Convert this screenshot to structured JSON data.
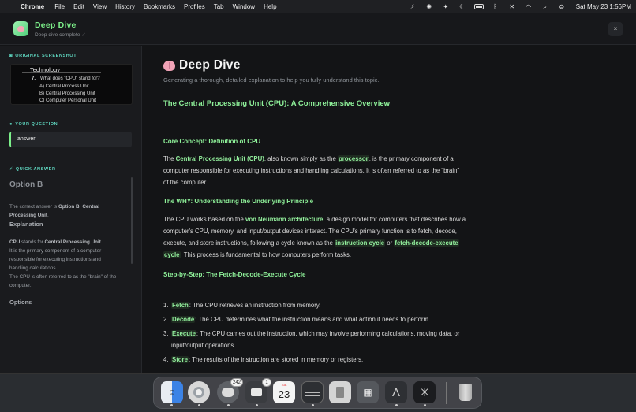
{
  "menubar": {
    "app": "Chrome",
    "items": [
      "File",
      "Edit",
      "View",
      "History",
      "Bookmarks",
      "Profiles",
      "Tab",
      "Window",
      "Help"
    ],
    "clock": "Sat May 23  1:56PM",
    "status_icons": [
      "bolt-icon",
      "brightness-icon",
      "sparkle-icon",
      "moon-icon",
      "battery-icon",
      "bluetooth-icon",
      "mute-icon",
      "wifi-icon",
      "search-icon",
      "control-center-icon"
    ]
  },
  "header": {
    "title": "Deep Dive",
    "subtitle": "Deep dive complete ✓",
    "close": "×"
  },
  "left": {
    "screenshot_label": "ORIGINAL SCREENSHOT",
    "screenshot": {
      "topic": "Technology",
      "question_num": "7.",
      "question": "What does \"CPU\" stand for?",
      "options": [
        "A) Central Process Unit",
        "B) Central Processing Unit",
        "C) Computer Personal Unit"
      ]
    },
    "question_label": "YOUR QUESTION",
    "question_value": "answer",
    "quick_label": "QUICK ANSWER",
    "quick": {
      "option": "Option B",
      "para1_a": "The correct answer is ",
      "para1_b": "Option B: Central Processing Unit",
      "para1_c": ".",
      "explanation_heading": "Explanation",
      "para2_a": "CPU",
      "para2_b": " stands for ",
      "para2_c": "Central Processing Unit",
      "para2_d": ".",
      "para3": "It is the primary component of a computer responsible for executing instructions and handling calculations.",
      "para4": "The CPU is often referred to as the \"brain\" of the computer.",
      "options_heading": "Options"
    }
  },
  "main": {
    "title": "Deep Dive",
    "subtitle": "Generating a thorough, detailed explanation to help you fully understand this topic.",
    "overview_heading": "The Central Processing Unit (CPU): A Comprehensive Overview",
    "core_heading": "Core Concept: Definition of CPU",
    "core": {
      "a": "The ",
      "b": "Central Processing Unit (CPU)",
      "c": ", also known simply as the ",
      "d": "processor",
      "e": ", is the primary component of a",
      "f": "computer responsible for executing instructions and handling calculations. It is often referred to as the \"brain\"",
      "g": "of the computer."
    },
    "why_heading": "The WHY: Understanding the Underlying Principle",
    "why": {
      "a": "The CPU works based on the ",
      "b": "von Neumann architecture",
      "c": ", a design model for computers that describes how a",
      "d": "computer's CPU, memory, and input/output devices interact. The CPU's primary function is to fetch, decode,",
      "e": "execute, and store instructions, following a cycle known as the ",
      "f": "instruction cycle",
      "g": " or ",
      "h": "fetch-decode-execute",
      "i": "cycle",
      "j": ". This process is fundamental to how computers perform tasks."
    },
    "steps_heading": "Step-by-Step: The Fetch-Decode-Execute Cycle",
    "steps": [
      {
        "num": "1.",
        "term": "Fetch",
        "text": ": The CPU retrieves an instruction from memory."
      },
      {
        "num": "2.",
        "term": "Decode",
        "text": ": The CPU determines what the instruction means and what action it needs to perform."
      },
      {
        "num": "3.",
        "term": "Execute",
        "text": ": The CPU carries out the instruction, which may involve performing calculations, moving data, or",
        "text2": "input/output operations."
      },
      {
        "num": "4.",
        "term": "Store",
        "text": ": The results of the instruction are stored in memory or registers."
      }
    ]
  },
  "dock": {
    "messages_badge": "242",
    "facetime_badge": "1",
    "calendar_day": "Sat",
    "calendar_date": "23"
  },
  "colors": {
    "accent_green": "#8ff29a",
    "section_teal": "#5fd7c0",
    "background": "#131416"
  }
}
